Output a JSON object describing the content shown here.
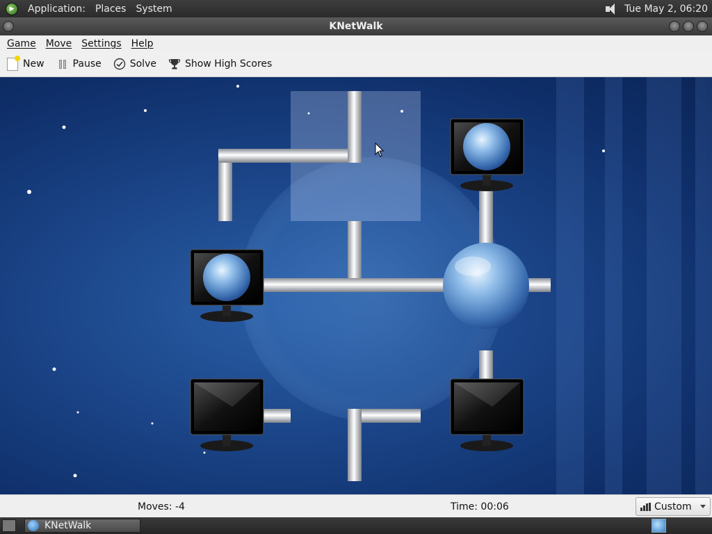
{
  "top_panel": {
    "applications": "Application:",
    "places": "Places",
    "system": "System",
    "clock": "Tue May  2, 06:20",
    "icons": [
      "app-menu-icon",
      "speaker-icon"
    ]
  },
  "window": {
    "title": "KNetWalk"
  },
  "menubar": {
    "game": "Game",
    "move": "Move",
    "settings": "Settings",
    "help": "Help"
  },
  "toolbar": {
    "new_label": "New",
    "pause_label": "Pause",
    "solve_label": "Solve",
    "highscores_label": "Show High Scores"
  },
  "statusbar": {
    "moves": "Moves: -4",
    "time": "Time: 00:06",
    "difficulty": "Custom"
  },
  "taskbar": {
    "item_label": "KNetWalk"
  },
  "board": {
    "grid": "5x5",
    "tiles": [
      {
        "row": 0,
        "col": 1,
        "type": "corner-pipe",
        "connects": [
          "right",
          "down"
        ]
      },
      {
        "row": 0,
        "col": 2,
        "type": "corner-pipe",
        "connects": [
          "up",
          "left"
        ],
        "highlighted": true
      },
      {
        "row": 0,
        "col": 3,
        "type": "terminal",
        "connected": true,
        "connects": [
          "down"
        ]
      },
      {
        "row": 1,
        "col": 1,
        "type": "terminal",
        "connected": true,
        "connects": [
          "right"
        ]
      },
      {
        "row": 1,
        "col": 2,
        "type": "t-pipe",
        "connects": [
          "up",
          "left",
          "right"
        ]
      },
      {
        "row": 1,
        "col": 3,
        "type": "server",
        "connects": [
          "up",
          "left",
          "right",
          "down"
        ]
      },
      {
        "row": 2,
        "col": 1,
        "type": "terminal",
        "connected": false,
        "connects": [
          "right"
        ]
      },
      {
        "row": 2,
        "col": 2,
        "type": "corner-pipe",
        "connects": [
          "right",
          "down"
        ]
      },
      {
        "row": 2,
        "col": 3,
        "type": "terminal",
        "connected": false,
        "connects": [
          "up"
        ]
      }
    ]
  }
}
